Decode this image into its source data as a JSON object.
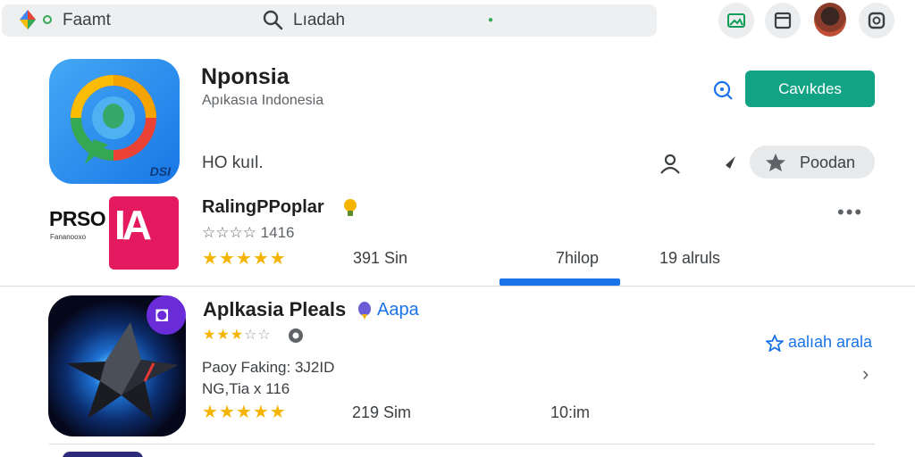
{
  "topbar": {
    "app_name": "Faamt",
    "search_text": "Lıadah"
  },
  "featured": {
    "title": "Nponsia",
    "subtitle": "Apıkasıa Indonesia",
    "meta": "HO kuıl.",
    "install_label": "Cavıkdes",
    "rate_label": "Poodan",
    "badge_text": "DSI"
  },
  "popular": {
    "tile_text": "PRSO",
    "tile_small": "Fananooxo",
    "section_title": "RalingPPoplar",
    "rating_text": "☆☆☆☆ 1416",
    "rating_value": 4.5,
    "size": "391 Sin",
    "installs": "7hilop",
    "reviews": "19 alruls"
  },
  "app2": {
    "title": "Aplkasia Pleals",
    "link": "Aapa",
    "rating_value": 3,
    "save_label": "aalıah arala",
    "line1": "Paoy Faking: 3J2ID",
    "line2": "NG,Tia x 116",
    "rating2_value": 4.5,
    "size": "219 Sim",
    "installs": "10:im"
  },
  "colors": {
    "accent": "#12a385",
    "link": "#1a73e8",
    "star": "#f4b400"
  }
}
